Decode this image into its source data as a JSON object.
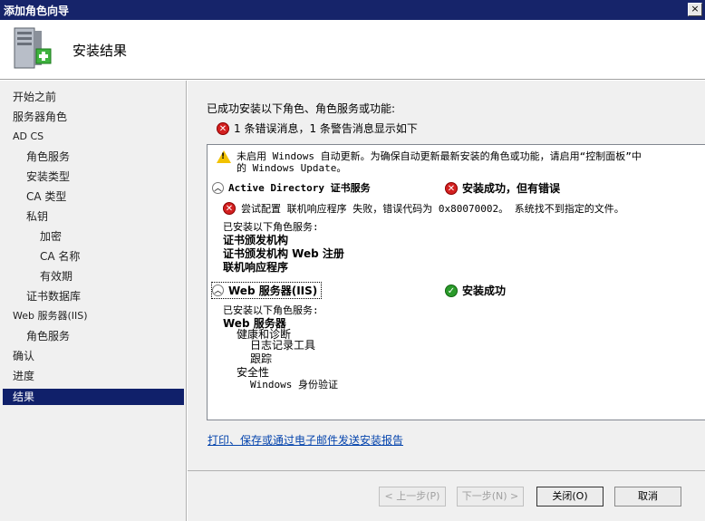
{
  "window": {
    "title": "添加角色向导",
    "close_glyph": "×"
  },
  "header": {
    "title": "安装结果",
    "icon": "server-add-icon"
  },
  "sidebar": {
    "items": [
      {
        "label": "开始之前",
        "indent": 0
      },
      {
        "label": "服务器角色",
        "indent": 0
      },
      {
        "label": "AD CS",
        "indent": 0
      },
      {
        "label": "角色服务",
        "indent": 1
      },
      {
        "label": "安装类型",
        "indent": 1
      },
      {
        "label": "CA 类型",
        "indent": 1
      },
      {
        "label": "私钥",
        "indent": 1
      },
      {
        "label": "加密",
        "indent": 2
      },
      {
        "label": "CA 名称",
        "indent": 2
      },
      {
        "label": "有效期",
        "indent": 2
      },
      {
        "label": "证书数据库",
        "indent": 1
      },
      {
        "label": "Web 服务器(IIS)",
        "indent": 0
      },
      {
        "label": "角色服务",
        "indent": 1
      },
      {
        "label": "确认",
        "indent": 0
      },
      {
        "label": "进度",
        "indent": 0
      },
      {
        "label": "结果",
        "indent": 0,
        "active": true
      }
    ]
  },
  "main": {
    "lead": "已成功安装以下角色、角色服务或功能:",
    "summary": "1 条错误消息，1 条警告消息显示如下",
    "report": {
      "warning_line1": "未启用 Windows 自动更新。为确保自动更新最新安装的角色或功能，请启用“控制面板”中",
      "warning_line2": "的 Windows Update。",
      "sections": [
        {
          "title": "Active Directory 证书服务",
          "status": "安装成功，但有错误",
          "error": "尝试配置 联机响应程序 失败，错误代码为 0x80070002。  系统找不到指定的文件。",
          "installed_label": "已安装以下角色服务:",
          "items": [
            "证书颁发机构",
            "证书颁发机构 Web 注册",
            "联机响应程序"
          ]
        },
        {
          "title": "Web 服务器(IIS)",
          "status": "安装成功",
          "installed_label": "已安装以下角色服务:",
          "tree": [
            {
              "label": "Web 服务器",
              "level": 0
            },
            {
              "label": "健康和诊断",
              "level": 1
            },
            {
              "label": "日志记录工具",
              "level": 2
            },
            {
              "label": "跟踪",
              "level": 2
            },
            {
              "label": "安全性",
              "level": 1
            },
            {
              "label": "Windows 身份验证",
              "level": 2
            }
          ]
        }
      ]
    },
    "report_link": "打印、保存或通过电子邮件发送安装报告"
  },
  "footer": {
    "prev": "< 上一步(P)",
    "next": "下一步(N) >",
    "close": "关闭(O)",
    "cancel": "取消"
  },
  "colors": {
    "titlebar": "#16246a",
    "active_nav": "#10206a",
    "link": "#0645ad",
    "error": "#d32020",
    "success": "#2a9a2a"
  }
}
